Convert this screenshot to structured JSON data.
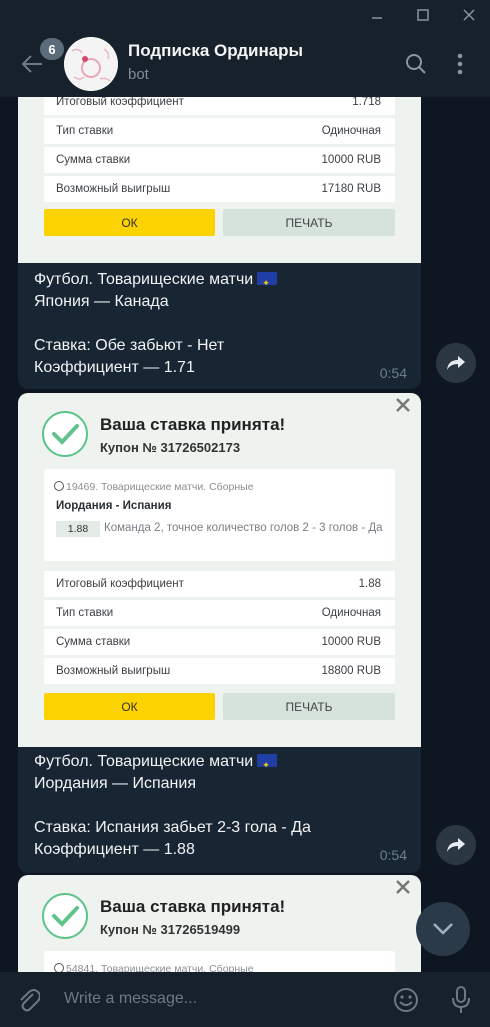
{
  "window": {
    "minimize_icon": "minimize-icon",
    "maximize_icon": "maximize-icon",
    "close_icon": "close-icon"
  },
  "header": {
    "unread_count": "6",
    "title": "Подписка Ординары",
    "subtitle": "bot"
  },
  "messages": [
    {
      "card": {
        "rows": [
          {
            "label": "Итоговый коэффициент",
            "value": "1.718"
          },
          {
            "label": "Тип ставки",
            "value": "Одиночная"
          },
          {
            "label": "Сумма ставки",
            "value": "10000 RUB"
          },
          {
            "label": "Возможный выигрыш",
            "value": "17180 RUB"
          }
        ],
        "ok_label": "ОК",
        "print_label": "ПЕЧАТЬ"
      },
      "line1": "Футбол. Товарищеские матчи",
      "line2": "Япония — Канада",
      "line3": "Ставка: Обе забьют - Нет",
      "line4": "Коэффициент — 1.71",
      "time": "0:54"
    },
    {
      "card": {
        "title": "Ваша ставка принята!",
        "coupon": "Купон № 31726502173",
        "event_header": "19469. Товарищеские матчи. Сборные",
        "event_match": "Иордания - Испания",
        "event_coef": "1.88",
        "event_desc": "Команда 2, точное количество голов 2 - 3 голов - Да",
        "rows": [
          {
            "label": "Итоговый коэффициент",
            "value": "1.88"
          },
          {
            "label": "Тип ставки",
            "value": "Одиночная"
          },
          {
            "label": "Сумма ставки",
            "value": "10000 RUB"
          },
          {
            "label": "Возможный выигрыш",
            "value": "18800 RUB"
          }
        ],
        "ok_label": "ОК",
        "print_label": "ПЕЧАТЬ"
      },
      "line1": "Футбол. Товарищеские матчи",
      "line2": "Иордания — Испания",
      "line3": "Ставка: Испания забьет 2-3 гола - Да",
      "line4": "Коэффициент — 1.88",
      "time": "0:54"
    },
    {
      "card": {
        "title": "Ваша ставка принята!",
        "coupon": "Купон № 31726519499",
        "event_header": "54841. Товарищеские матчи. Сборные"
      }
    }
  ],
  "composer": {
    "placeholder": "Write a message..."
  }
}
